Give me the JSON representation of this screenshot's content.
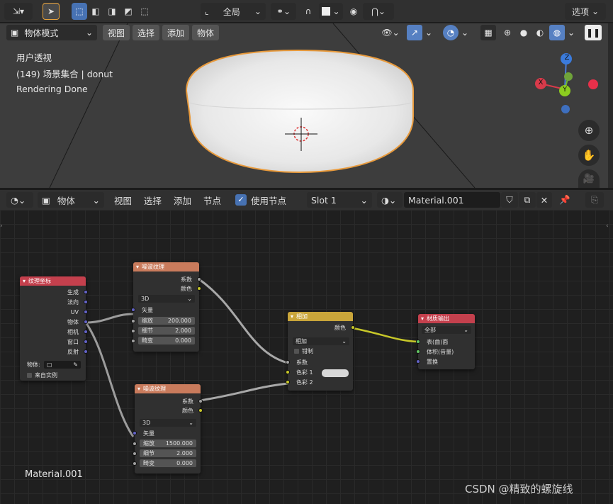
{
  "topbar": {
    "global_label": "全局",
    "options_label": "选项"
  },
  "viewport": {
    "header": {
      "mode_label": "物体模式",
      "menus": [
        "视图",
        "选择",
        "添加",
        "物体"
      ]
    },
    "overlay": {
      "view_name": "用户透视",
      "collection_line": "(149) 场景集合 | donut",
      "status": "Rendering Done"
    },
    "gizmo": {
      "x": "X",
      "y": "Y",
      "z": "Z"
    }
  },
  "node_editor": {
    "header": {
      "type_label": "物体",
      "menus": [
        "视图",
        "选择",
        "添加",
        "节点"
      ],
      "use_nodes_label": "使用节点",
      "slot_label": "Slot 1",
      "material_name": "Material.001"
    },
    "material_label": "Material.001",
    "watermark": "CSDN @精致的螺旋线",
    "nodes": {
      "texcoord": {
        "title": "纹理坐标",
        "outputs": [
          "生成",
          "法向",
          "UV",
          "物体",
          "相机",
          "窗口",
          "反射"
        ],
        "object_label": "物体:",
        "from_instancer": "来自实例"
      },
      "noise1": {
        "title": "噪波纹理",
        "outputs": [
          "系数",
          "颜色"
        ],
        "dimension": "3D",
        "vector_label": "矢量",
        "fields": [
          {
            "label": "缩放",
            "value": "200.000"
          },
          {
            "label": "细节",
            "value": "2.000"
          },
          {
            "label": "畸变",
            "value": "0.000"
          }
        ]
      },
      "noise2": {
        "title": "噪波纹理",
        "outputs": [
          "系数",
          "颜色"
        ],
        "dimension": "3D",
        "vector_label": "矢量",
        "fields": [
          {
            "label": "缩放",
            "value": "1500.000"
          },
          {
            "label": "细节",
            "value": "2.000"
          },
          {
            "label": "畸变",
            "value": "0.000"
          }
        ]
      },
      "mix": {
        "title": "相加",
        "output": "颜色",
        "blend_mode": "相加",
        "clamp_label": "钳制",
        "inputs": [
          "系数",
          "色彩 1",
          "色彩 2"
        ]
      },
      "output": {
        "title": "材质输出",
        "target": "全部",
        "inputs": [
          "表(曲)面",
          "体积(音量)",
          "置换"
        ]
      }
    }
  },
  "colors": {
    "texture_header": "#c97b5c",
    "input_header": "#c4404d",
    "color_header": "#c9a53a",
    "output_header": "#c4404d",
    "socket_vector": "#6363c7",
    "socket_float": "#a1a1a1",
    "socket_color": "#c7c729",
    "socket_shader": "#63c763",
    "accent": "#4772b3",
    "selection_outline": "#e89a3c"
  }
}
